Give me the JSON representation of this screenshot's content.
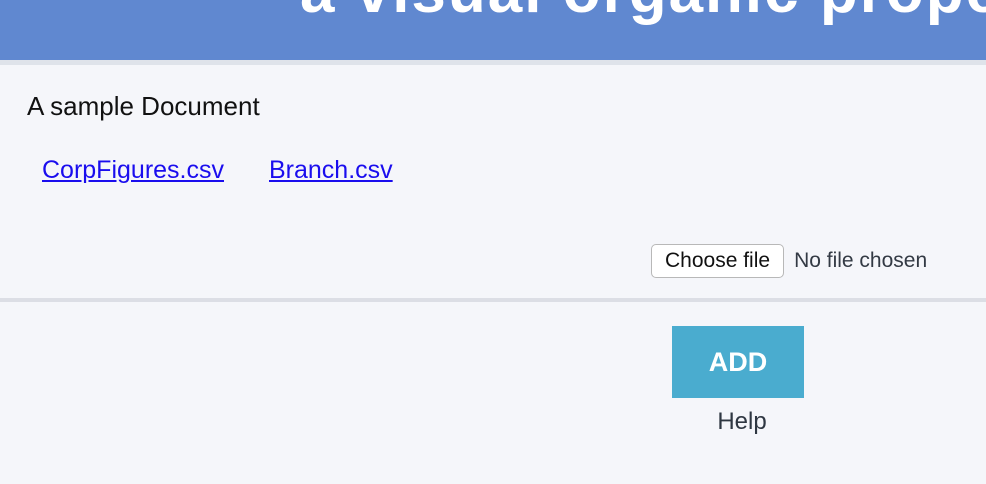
{
  "header": {
    "title": "a visual organic properties study",
    "background_color": "#6088d0"
  },
  "document": {
    "title": "A sample Document",
    "links": [
      {
        "label": "CorpFigures.csv"
      },
      {
        "label": "Branch.csv"
      }
    ],
    "file_input": {
      "button_label": "Choose file",
      "status": "No file chosen"
    }
  },
  "actions": {
    "add_label": "ADD",
    "add_color": "#4aaccf",
    "help_label": "Help"
  },
  "colors": {
    "link": "#1a0dee",
    "page_background": "#f5f6fa"
  }
}
